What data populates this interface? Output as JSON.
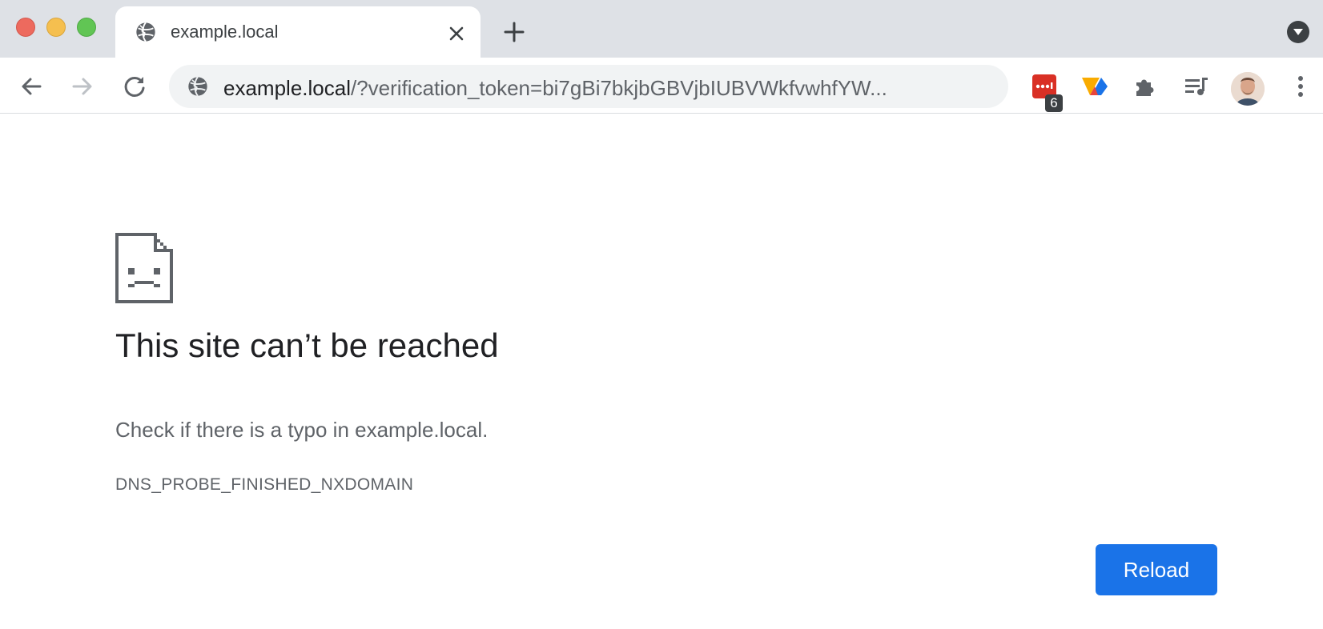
{
  "window": {
    "traffic_lights": [
      "close",
      "minimize",
      "zoom"
    ]
  },
  "tabs": [
    {
      "title": "example.local",
      "favicon": "globe-icon",
      "active": true
    }
  ],
  "toolbar": {
    "back": "arrow-left-icon",
    "forward": "arrow-right-icon",
    "reload": "reload-icon",
    "omnibox": {
      "host": "example.local",
      "path": "/?verification_token=bi7gBi7bkjbGBVjbIUBVWkfvwhfYW..."
    },
    "extensions": [
      {
        "name": "red-extension-icon",
        "badge": "6"
      },
      {
        "name": "blue-orange-extension-icon"
      },
      {
        "name": "puzzle-piece-icon"
      },
      {
        "name": "media-queue-icon"
      }
    ],
    "menu": "kebab-menu-icon"
  },
  "error_page": {
    "heading": "This site can’t be reached",
    "description": "Check if there is a typo in example.local.",
    "error_code": "DNS_PROBE_FINISHED_NXDOMAIN",
    "reload_label": "Reload"
  },
  "colors": {
    "accent": "#1a73e8",
    "tabstrip": "#dee1e6",
    "omnibox": "#f1f3f4"
  }
}
